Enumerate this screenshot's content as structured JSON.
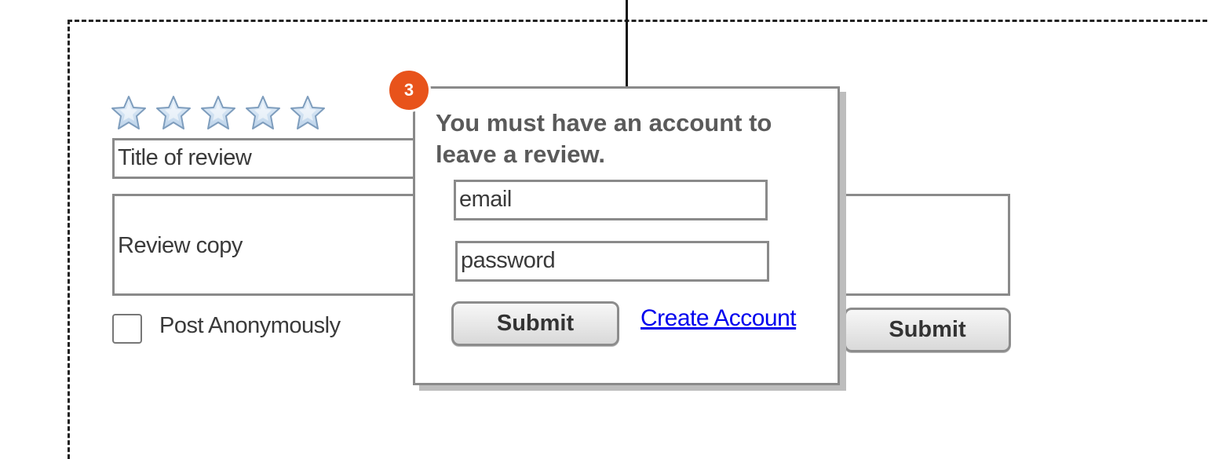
{
  "review_form": {
    "rating": {
      "max": 5,
      "value": 0,
      "icon": "star-icon"
    },
    "title_placeholder": "Title of review",
    "copy_placeholder": "Review copy",
    "anonymous_label": "Post Anonymously",
    "anonymous_checked": false,
    "submit_label": "Submit"
  },
  "login_popup": {
    "badge_number": "3",
    "message": "You must have an account to leave a review.",
    "email_placeholder": "email",
    "password_placeholder": "password",
    "submit_label": "Submit",
    "create_account_label": "Create Account"
  },
  "colors": {
    "badge": "#e8531b",
    "link": "#0000ee",
    "border": "#8a8a8a"
  }
}
